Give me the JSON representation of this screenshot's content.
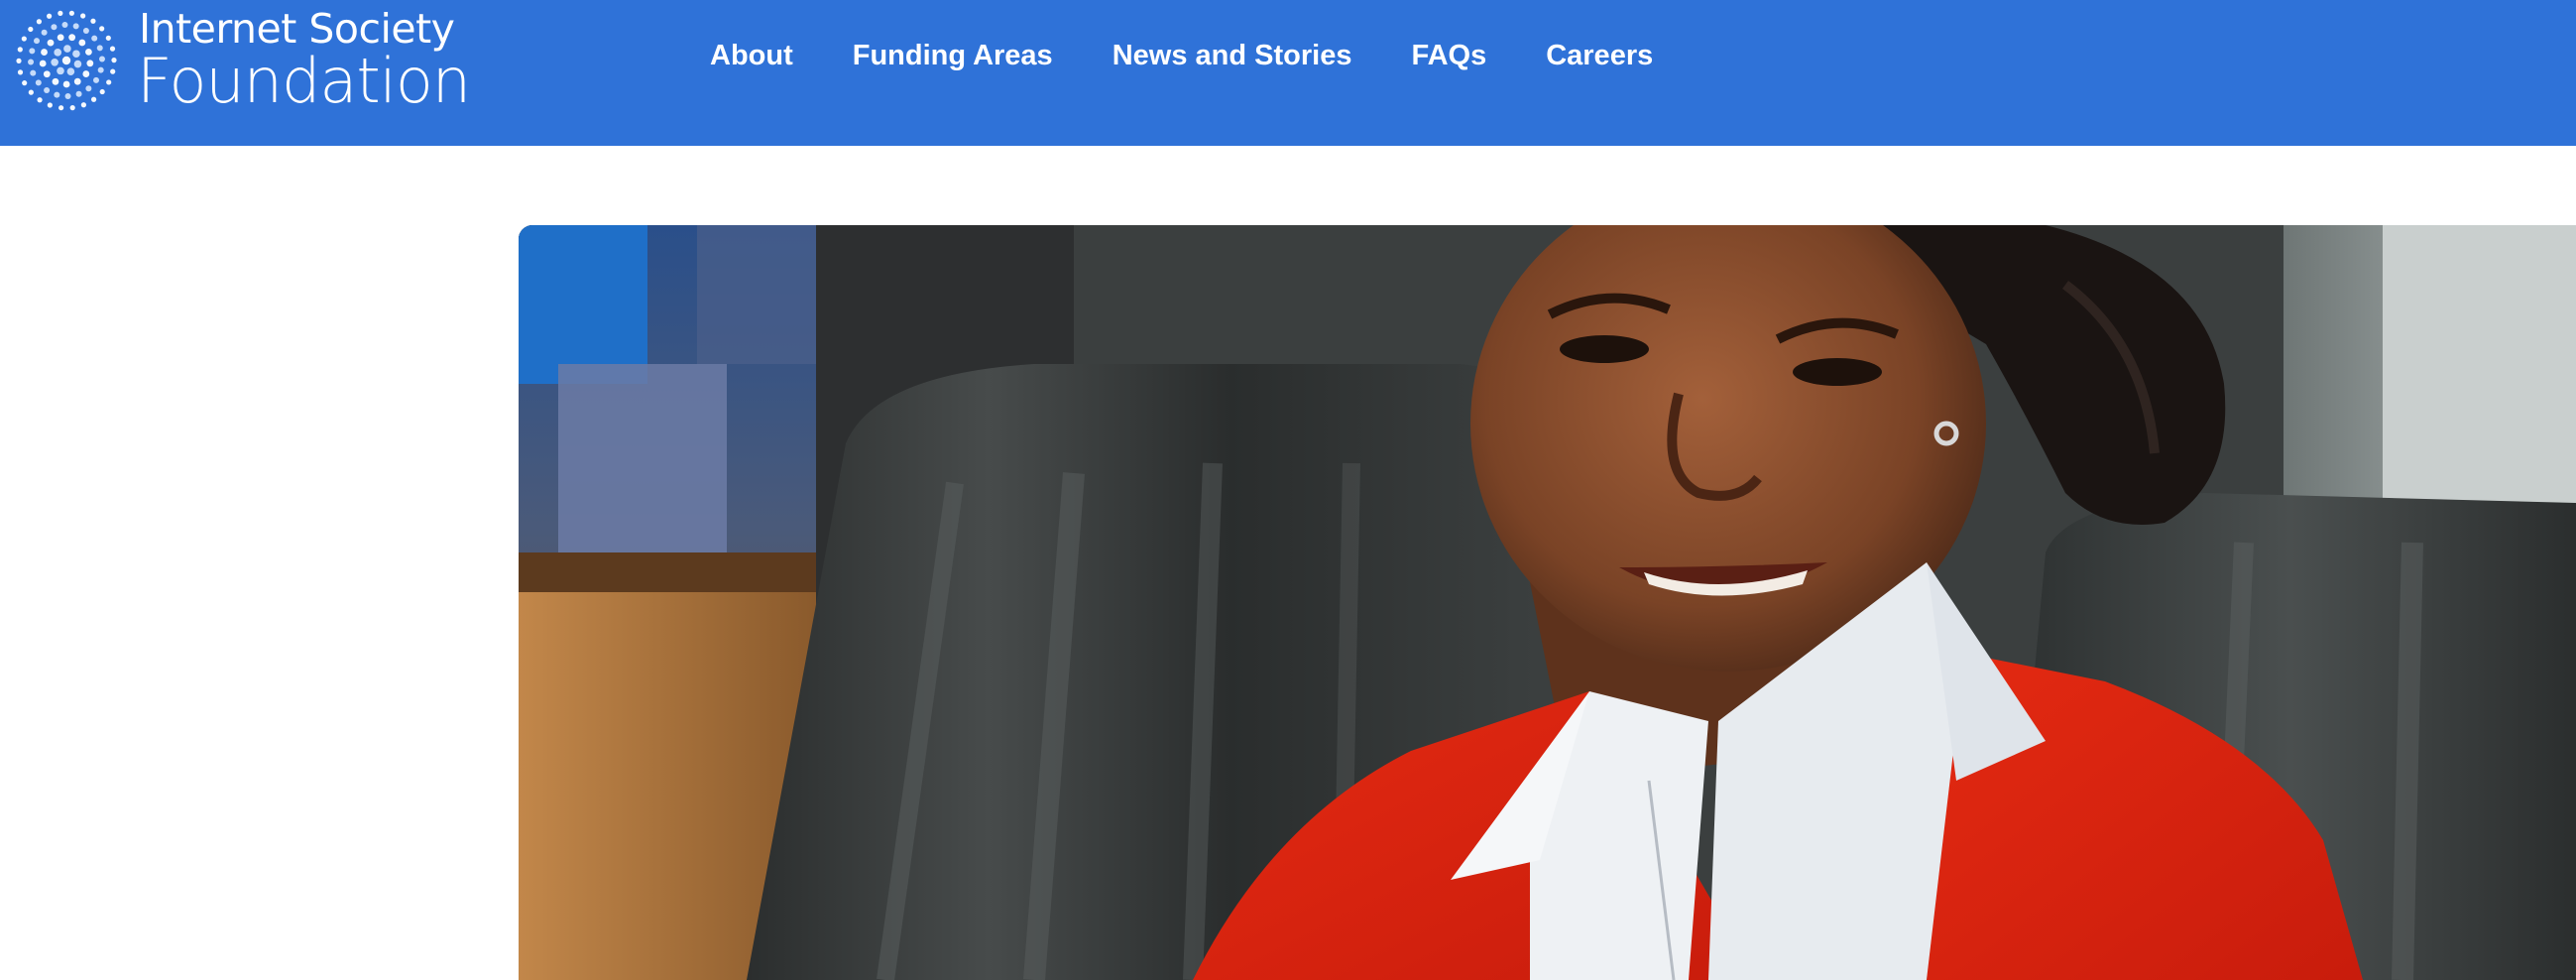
{
  "header": {
    "logo": {
      "line1": "Internet Society",
      "line2": "Foundation",
      "icon": "dot-globe-icon"
    },
    "nav": [
      {
        "label": "About"
      },
      {
        "label": "Funding Areas"
      },
      {
        "label": "News and Stories"
      },
      {
        "label": "FAQs"
      },
      {
        "label": "Careers"
      }
    ],
    "color": "#2f72d8"
  },
  "hero": {
    "image": "photo-woman-red-cardigan"
  }
}
